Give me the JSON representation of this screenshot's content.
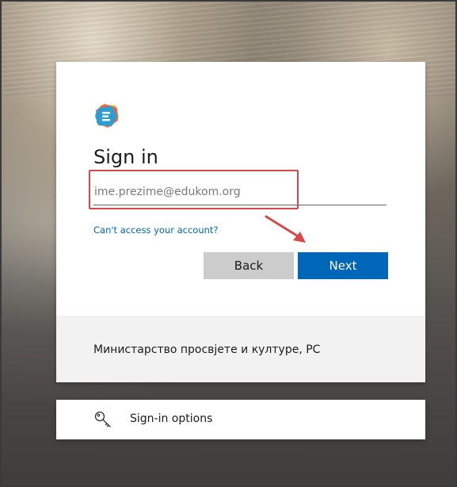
{
  "signin": {
    "title": "Sign in",
    "email_placeholder": "ime.prezime@edukom.org",
    "email_value": "",
    "cant_access_link": "Can't access your account?",
    "back_label": "Back",
    "next_label": "Next",
    "organization": "Министарство просвјете и културе, РС"
  },
  "options": {
    "label": "Sign-in options",
    "icon": "key-icon"
  },
  "colors": {
    "accent": "#0067b8",
    "back_button": "#cccccc",
    "highlight": "#d94848",
    "footer_band": "#f2f2f2"
  }
}
